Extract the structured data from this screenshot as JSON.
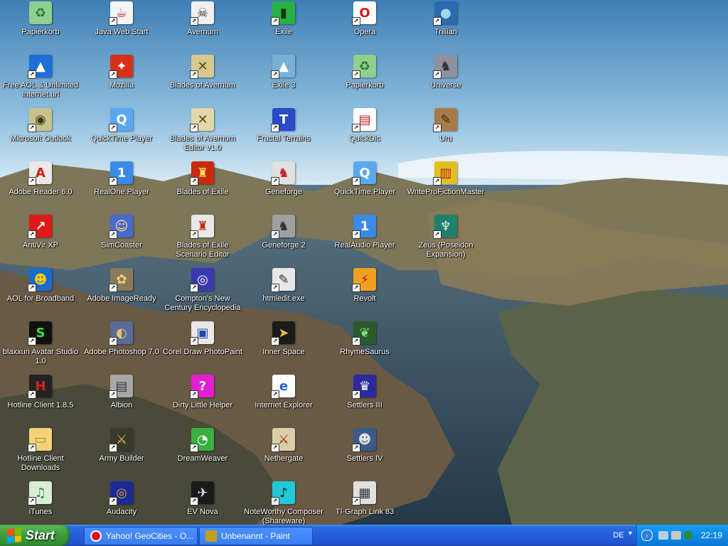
{
  "icons": [
    {
      "label": "Papierkorb",
      "icon": "recycle-bin-icon",
      "bg": "#8fd08f",
      "glyph": "♻",
      "fg": "#2a7a2a"
    },
    {
      "label": "Free AOL & Unlimited Internet.url",
      "icon": "aol-icon",
      "bg": "#1e6ed6",
      "glyph": "▲",
      "fg": "#ffffff"
    },
    {
      "label": "Microsoft Outlook",
      "icon": "outlook-icon",
      "bg": "#c8c28a",
      "glyph": "◉",
      "fg": "#3a3a1a"
    },
    {
      "label": "Adobe Reader 6.0",
      "icon": "adobe-reader-icon",
      "bg": "#e8e8e8",
      "glyph": "A",
      "fg": "#cc1a1a"
    },
    {
      "label": "AntiVir XP",
      "icon": "antivir-icon",
      "bg": "#e01818",
      "glyph": "↗",
      "fg": "#ffffff"
    },
    {
      "label": "AOL for Broadband",
      "icon": "aol-broadband-icon",
      "bg": "#1a6ad0",
      "glyph": "☻",
      "fg": "#ffcc00"
    },
    {
      "label": "blaxxun Avatar Studio 1.0",
      "icon": "blaxxun-icon",
      "bg": "#101010",
      "glyph": "S",
      "fg": "#40e040"
    },
    {
      "label": "Hotline Client 1.8.5",
      "icon": "hotline-icon",
      "bg": "#222222",
      "glyph": "H",
      "fg": "#e02020"
    },
    {
      "label": "Hotline Client Downloads",
      "icon": "folder-icon",
      "bg": "#f2d27a",
      "glyph": "▭",
      "fg": "#b08a20"
    },
    {
      "label": "iTunes",
      "icon": "itunes-icon",
      "bg": "#d8ecd8",
      "glyph": "♫",
      "fg": "#2a8a2a"
    },
    {
      "label": "Java Web Start",
      "icon": "java-icon",
      "bg": "#f4f4f4",
      "glyph": "☕",
      "fg": "#c0392b"
    },
    {
      "label": "Mozilla",
      "icon": "mozilla-icon",
      "bg": "#d83018",
      "glyph": "✦",
      "fg": "#ffffff"
    },
    {
      "label": "QuickTime Player",
      "icon": "quicktime-icon",
      "bg": "#5aa8f0",
      "glyph": "Q",
      "fg": "#ffffff"
    },
    {
      "label": "RealOne Player",
      "icon": "realone-icon",
      "bg": "#3a8ae8",
      "glyph": "1",
      "fg": "#ffffff"
    },
    {
      "label": "SimCoaster",
      "icon": "simcoaster-icon",
      "bg": "#4a6ad0",
      "glyph": "☺",
      "fg": "#ffe080"
    },
    {
      "label": "Adobe ImageReady",
      "icon": "imageready-icon",
      "bg": "#8a7a5a",
      "glyph": "✿",
      "fg": "#f0d080"
    },
    {
      "label": "Adobe Photoshop 7.0",
      "icon": "photoshop-icon",
      "bg": "#5a6a9a",
      "glyph": "◐",
      "fg": "#f0c060"
    },
    {
      "label": "Albion",
      "icon": "albion-icon",
      "bg": "#a8a8a8",
      "glyph": "▤",
      "fg": "#333333"
    },
    {
      "label": "Army Builder",
      "icon": "army-builder-icon",
      "bg": "#3a3a2a",
      "glyph": "⚔",
      "fg": "#e0c040"
    },
    {
      "label": "Audacity",
      "icon": "audacity-icon",
      "bg": "#1a2a9a",
      "glyph": "◎",
      "fg": "#f0a020"
    },
    {
      "label": "Avernum",
      "icon": "avernum-icon",
      "bg": "#f0f0f0",
      "glyph": "☠",
      "fg": "#333333"
    },
    {
      "label": "Blades of Avernum",
      "icon": "blades-avernum-icon",
      "bg": "#d8c890",
      "glyph": "✕",
      "fg": "#5a4a10"
    },
    {
      "label": "Blades of Avernum Editor v1.0",
      "icon": "blades-editor-icon",
      "bg": "#e0d8a8",
      "glyph": "✕",
      "fg": "#5a4a10"
    },
    {
      "label": "Blades of Exile",
      "icon": "blades-exile-icon",
      "bg": "#c82a10",
      "glyph": "♜",
      "fg": "#ffe060"
    },
    {
      "label": "Blades of Exile Scenario Editor",
      "icon": "blades-exile-editor-icon",
      "bg": "#e8e8e8",
      "glyph": "♜",
      "fg": "#c82a10"
    },
    {
      "label": "Compton's New Century Encyclopedia",
      "icon": "encyclopedia-icon",
      "bg": "#3a3ab0",
      "glyph": "◎",
      "fg": "#ffffff"
    },
    {
      "label": "Corel Draw PhotoPaint",
      "icon": "photopaint-icon",
      "bg": "#e8e8e8",
      "glyph": "▣",
      "fg": "#1a4ab0"
    },
    {
      "label": "Dirty Little Helper",
      "icon": "dirty-helper-icon",
      "bg": "#e020d0",
      "glyph": "?",
      "fg": "#ffffff"
    },
    {
      "label": "DreamWeaver",
      "icon": "dreamweaver-icon",
      "bg": "#3ab040",
      "glyph": "◔",
      "fg": "#ffffff"
    },
    {
      "label": "EV Nova",
      "icon": "ev-nova-icon",
      "bg": "#1a1a1a",
      "glyph": "✈",
      "fg": "#e0e0e0"
    },
    {
      "label": "Exile",
      "icon": "exile-icon",
      "bg": "#2ab040",
      "glyph": "▮",
      "fg": "#0a3a0a"
    },
    {
      "label": "Exile 3",
      "icon": "exile3-icon",
      "bg": "#7ab0d8",
      "glyph": "▲",
      "fg": "#ffffff"
    },
    {
      "label": "Fractal Terrains",
      "icon": "fractal-terrains-icon",
      "bg": "#2a4ac8",
      "glyph": "T",
      "fg": "#ffffff"
    },
    {
      "label": "Geneforge",
      "icon": "geneforge-icon",
      "bg": "#e0e0e0",
      "glyph": "♞",
      "fg": "#c02020"
    },
    {
      "label": "Geneforge 2",
      "icon": "geneforge2-icon",
      "bg": "#a0a0a0",
      "glyph": "♞",
      "fg": "#303030"
    },
    {
      "label": "htmledit.exe",
      "icon": "htmledit-icon",
      "bg": "#e8e8e8",
      "glyph": "✎",
      "fg": "#303030"
    },
    {
      "label": "Inner Space",
      "icon": "inner-space-icon",
      "bg": "#1a1a1a",
      "glyph": "➤",
      "fg": "#e0c040"
    },
    {
      "label": "Internet Explorer",
      "icon": "internet-explorer-icon",
      "bg": "#ffffff",
      "glyph": "e",
      "fg": "#1a6ad0"
    },
    {
      "label": "Nethergate",
      "icon": "nethergate-icon",
      "bg": "#d8d0a8",
      "glyph": "⚔",
      "fg": "#a02010"
    },
    {
      "label": "NoteWorthy Composer (Shareware)",
      "icon": "noteworthy-icon",
      "bg": "#20c8d8",
      "glyph": "♪",
      "fg": "#101010"
    },
    {
      "label": "Opera",
      "icon": "opera-icon",
      "bg": "#ffffff",
      "glyph": "O",
      "fg": "#d81818"
    },
    {
      "label": "Papierkorb",
      "icon": "recycle-bin-icon",
      "bg": "#8fd08f",
      "glyph": "♻",
      "fg": "#2a7a2a"
    },
    {
      "label": "QuickDic",
      "icon": "quickdic-icon",
      "bg": "#ffffff",
      "glyph": "▤",
      "fg": "#c81818"
    },
    {
      "label": "QuickTime Player",
      "icon": "quicktime-icon",
      "bg": "#5aa8f0",
      "glyph": "Q",
      "fg": "#ffffff"
    },
    {
      "label": "RealAudio Player",
      "icon": "realaudio-icon",
      "bg": "#3a8ae8",
      "glyph": "1",
      "fg": "#ffffff"
    },
    {
      "label": "Revolt",
      "icon": "revolt-icon",
      "bg": "#f0a020",
      "glyph": "⚡",
      "fg": "#d01010"
    },
    {
      "label": "RhymeSaurus",
      "icon": "rhymesaurus-icon",
      "bg": "#2a5a2a",
      "glyph": "❦",
      "fg": "#80e080"
    },
    {
      "label": "Settlers III",
      "icon": "settlers3-icon",
      "bg": "#2a2aa0",
      "glyph": "♛",
      "fg": "#ffffff"
    },
    {
      "label": "Settlers IV",
      "icon": "settlers4-icon",
      "bg": "#3a5a8a",
      "glyph": "☻",
      "fg": "#e0e0e0"
    },
    {
      "label": "TI-Graph Link 83",
      "icon": "ti-graph-icon",
      "bg": "#e0e0e0",
      "glyph": "▦",
      "fg": "#303030"
    },
    {
      "label": "Trillian",
      "icon": "trillian-icon",
      "bg": "#2a6ab0",
      "glyph": "●",
      "fg": "#a0d8f0"
    },
    {
      "label": "Universe",
      "icon": "universe-icon",
      "bg": "#9090a0",
      "glyph": "♞",
      "fg": "#303030"
    },
    {
      "label": "Uru",
      "icon": "uru-icon",
      "bg": "#a87a4a",
      "glyph": "✎",
      "fg": "#3a2a10"
    },
    {
      "label": "WriteProFictionMaster",
      "icon": "writepro-icon",
      "bg": "#e0c020",
      "glyph": "▥",
      "fg": "#c02020"
    },
    {
      "label": "Zeus (Poseidon Expansion)",
      "icon": "zeus-icon",
      "bg": "#208070",
      "glyph": "♆",
      "fg": "#e0f0e0"
    }
  ],
  "taskbar": {
    "start_label": "Start",
    "tasks": [
      {
        "label": "Yahoo! GeoCities - O...",
        "icon": "opera-icon",
        "color": "#d81818"
      },
      {
        "label": "Unbenannt - Paint",
        "icon": "paint-icon",
        "color": "#c0a020"
      }
    ],
    "language": "DE",
    "clock": "22:19"
  }
}
